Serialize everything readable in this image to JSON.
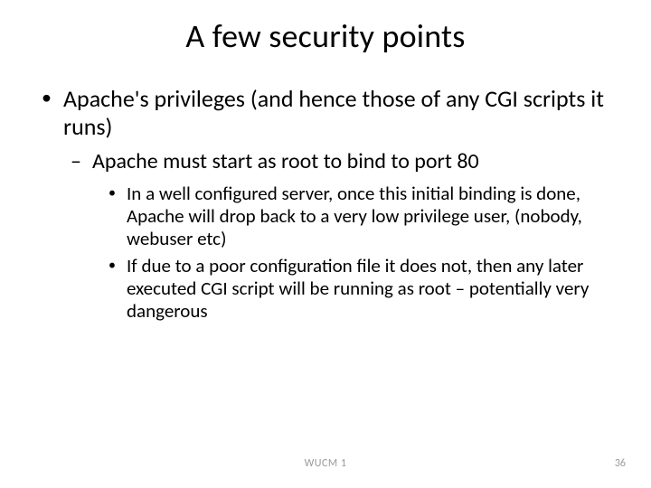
{
  "title": "A few security points",
  "bullets": {
    "l1": "Apache's privileges (and hence those of any CGI scripts it runs)",
    "l2": "Apache must start as root to bind to port 80",
    "l3a": "In a well configured server, once this initial binding is done, Apache will drop back to a very low privilege user, (nobody, webuser etc)",
    "l3b": "If due to a poor configuration file it does not, then any later executed CGI script will be running as root – potentially very dangerous"
  },
  "footer": "WUCM 1",
  "page": "36"
}
